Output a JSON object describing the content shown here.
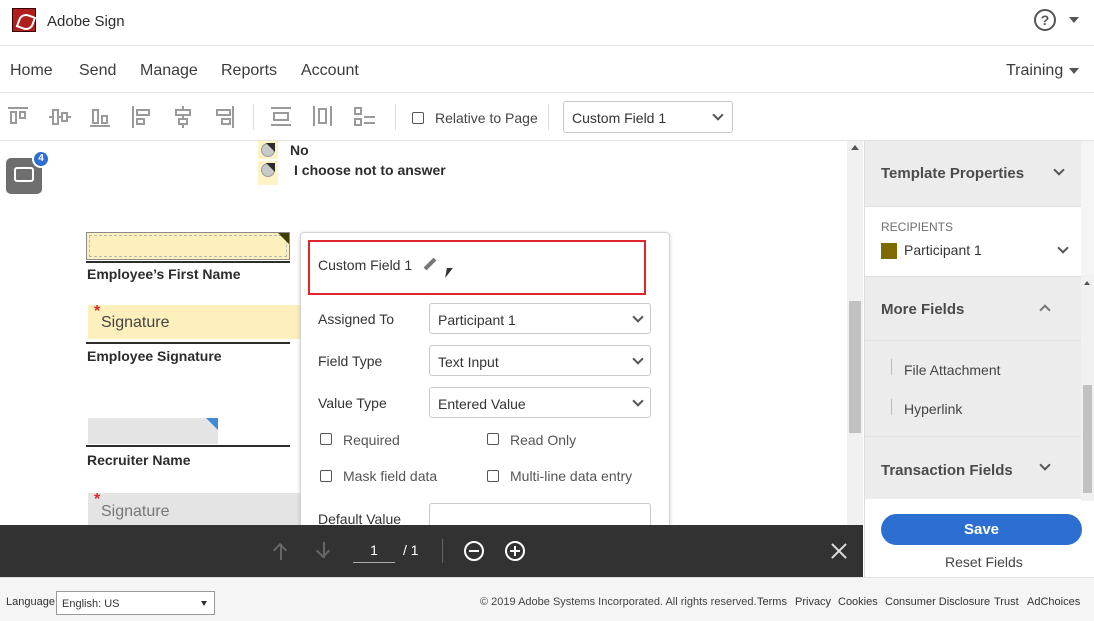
{
  "app": {
    "title": "Adobe Sign",
    "help_icon": "help-icon",
    "help_glyph": "?"
  },
  "nav": {
    "items": [
      "Home",
      "Send",
      "Manage",
      "Reports",
      "Account"
    ],
    "user_menu": "Training"
  },
  "toolbar": {
    "relative_label": "Relative to Page",
    "field_select": "Custom Field 1",
    "icons": [
      "align-top-icon",
      "align-middle-icon",
      "align-bottom-icon",
      "align-left-icon",
      "align-center-icon",
      "align-right-icon",
      "distribute-vertical-icon",
      "distribute-horizontal-icon",
      "match-size-icon"
    ]
  },
  "document": {
    "badge_count": "4",
    "options": [
      "No",
      "I choose not to answer"
    ],
    "fields": {
      "first_name_label": "Employee’s First Name",
      "signature_placeholder": "Signature",
      "employee_signature_label": "Employee Signature",
      "recruiter_name_label": "Recruiter Name",
      "signature2_placeholder": "Signature"
    }
  },
  "popup": {
    "field_name": "Custom Field 1",
    "assigned_to_label": "Assigned To",
    "assigned_to_value": "Participant 1",
    "field_type_label": "Field Type",
    "field_type_value": "Text Input",
    "value_type_label": "Value Type",
    "value_type_value": "Entered Value",
    "required_label": "Required",
    "read_only_label": "Read Only",
    "mask_label": "Mask field data",
    "multiline_label": "Multi-line data entry",
    "default_value_label": "Default Value"
  },
  "right_panel": {
    "template_properties": "Template Properties",
    "recipients_heading": "RECIPIENTS",
    "participant": "Participant 1",
    "participant_color": "#7d6a00",
    "more_fields": "More Fields",
    "more_items": [
      "File Attachment",
      "Hyperlink"
    ],
    "transaction_fields": "Transaction Fields",
    "save": "Save",
    "reset": "Reset Fields"
  },
  "pager": {
    "current": "1",
    "total": "/ 1"
  },
  "footer": {
    "language_label": "Language",
    "language_value": "English: US",
    "copyright": "© 2019 Adobe Systems Incorporated. All rights reserved.",
    "links": [
      "Terms",
      "Privacy",
      "Cookies",
      "Consumer Disclosure",
      "Trust",
      "AdChoices"
    ]
  },
  "colors": {
    "accent": "#2d6fd1",
    "highlight": "#fdf3c5",
    "popup_border": "#e0262c",
    "dark_bar": "#323232"
  }
}
